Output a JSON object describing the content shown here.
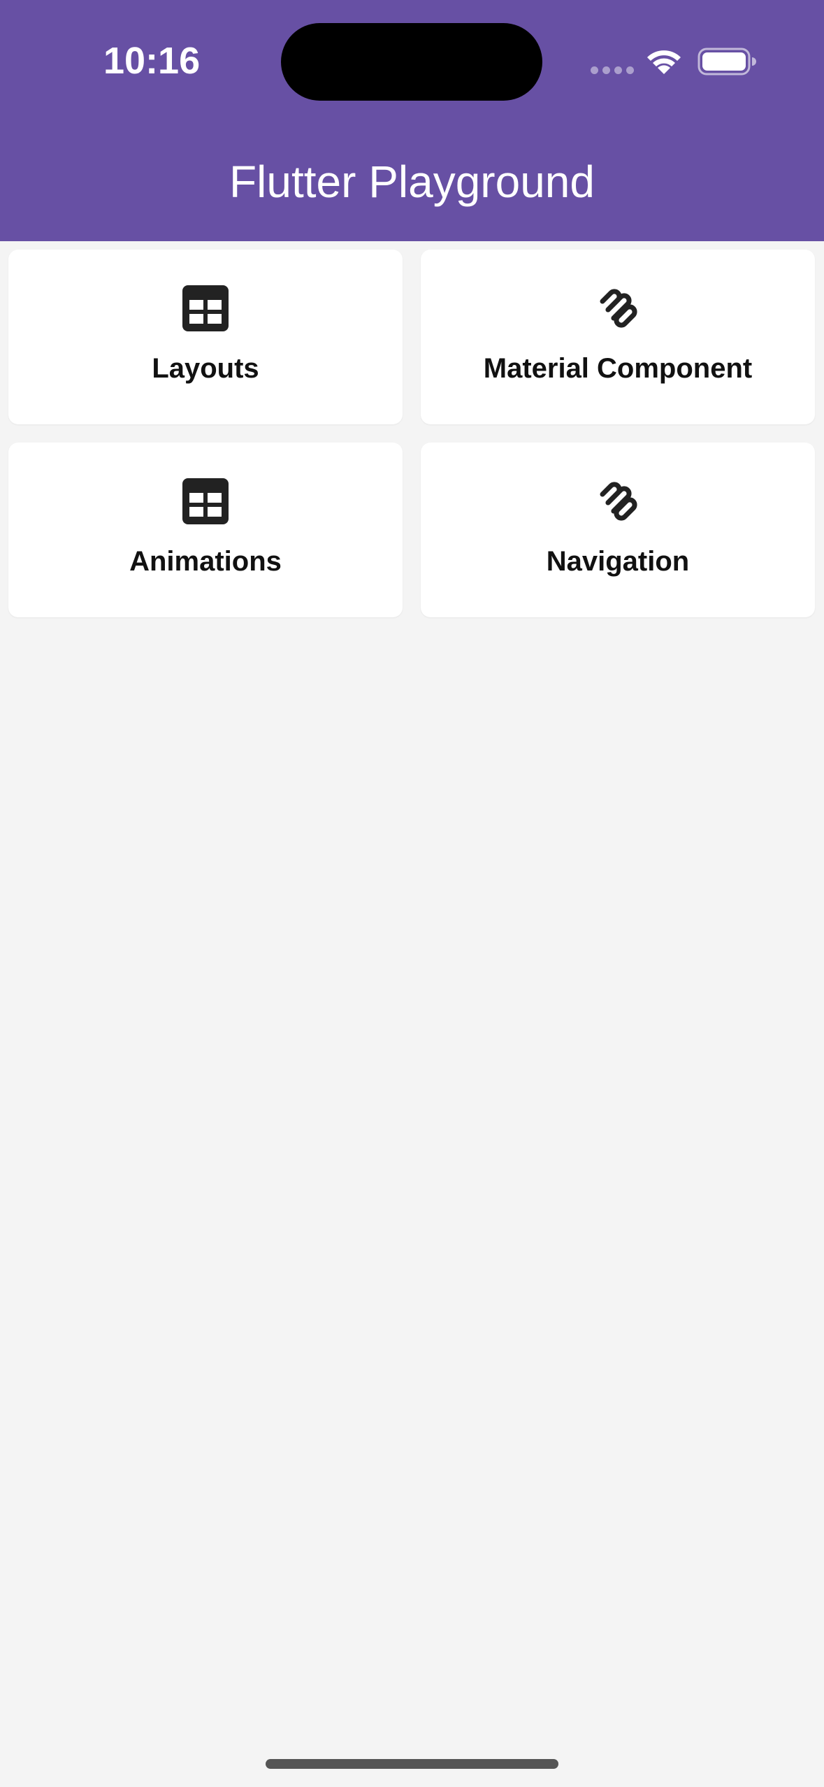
{
  "status_bar": {
    "time": "10:16"
  },
  "app_bar": {
    "title": "Flutter Playground",
    "background_color": "#6750a4"
  },
  "grid": {
    "items": [
      {
        "label": "Layouts",
        "icon": "table-grid-icon"
      },
      {
        "label": "Material Component",
        "icon": "squarespace-logo-icon"
      },
      {
        "label": "Animations",
        "icon": "table-grid-icon"
      },
      {
        "label": "Navigation",
        "icon": "squarespace-logo-icon"
      }
    ]
  }
}
